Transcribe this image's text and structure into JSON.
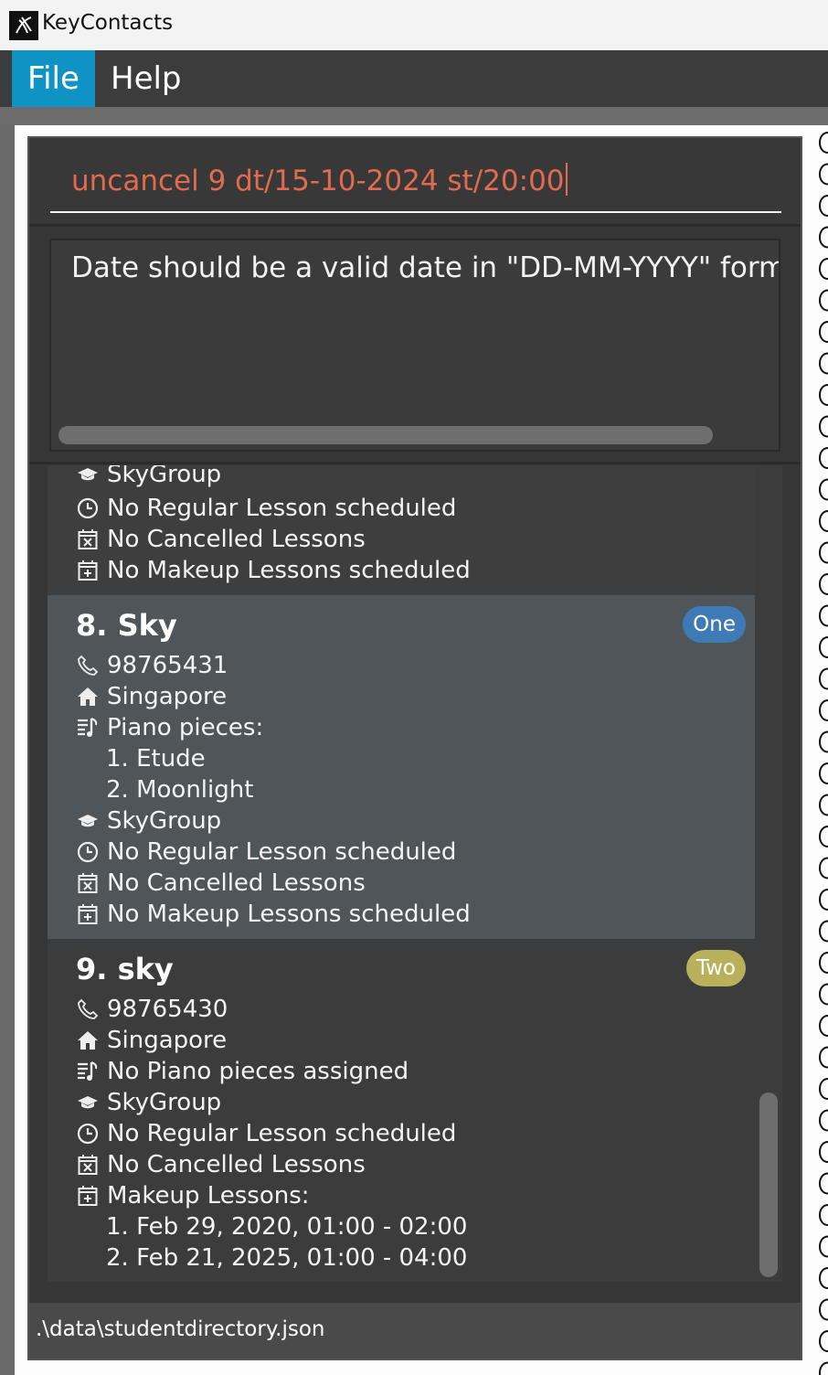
{
  "window": {
    "title": "KeyContacts"
  },
  "menu": {
    "file": "File",
    "help": "Help"
  },
  "command": {
    "text": "uncancel 9 dt/15-10-2024 st/20:00"
  },
  "result": {
    "text": "Date should be a valid date in \"DD-MM-YYYY\" format"
  },
  "cards": {
    "partial": {
      "group_clipped": "SkyGroup",
      "regular": "No Regular Lesson scheduled",
      "cancelled": "No Cancelled Lessons",
      "makeup": "No Makeup Lessons scheduled"
    },
    "c8": {
      "title": "8. Sky",
      "tag": "One",
      "phone": "98765431",
      "address": "Singapore",
      "pieces_label": "Piano pieces:",
      "pieces": [
        "1. Etude",
        "2. Moonlight"
      ],
      "group": "SkyGroup",
      "regular": "No Regular Lesson scheduled",
      "cancelled": "No Cancelled Lessons",
      "makeup": "No Makeup Lessons scheduled"
    },
    "c9": {
      "title": "9. sky",
      "tag": "Two",
      "phone": "98765430",
      "address": "Singapore",
      "pieces_label": "No Piano pieces assigned",
      "group": "SkyGroup",
      "regular": "No Regular Lesson scheduled",
      "cancelled": "No Cancelled Lessons",
      "makeup_label": "Makeup Lessons:",
      "makeups": [
        "1. Feb 29, 2020, 01:00 - 02:00",
        "2. Feb 21, 2025, 01:00 - 04:00"
      ]
    }
  },
  "status": {
    "path": ".\\data\\studentdirectory.json"
  },
  "colors": {
    "menu_active": "#0f93c4",
    "command_text": "#e06b4f",
    "tag_one": "#3e7bb6",
    "tag_two": "#b8b05a",
    "selected_card": "#4f5559"
  },
  "icons": [
    "phone-icon",
    "home-icon",
    "music-list-icon",
    "graduation-cap-icon",
    "clock-icon",
    "calendar-x-icon",
    "calendar-plus-icon"
  ]
}
